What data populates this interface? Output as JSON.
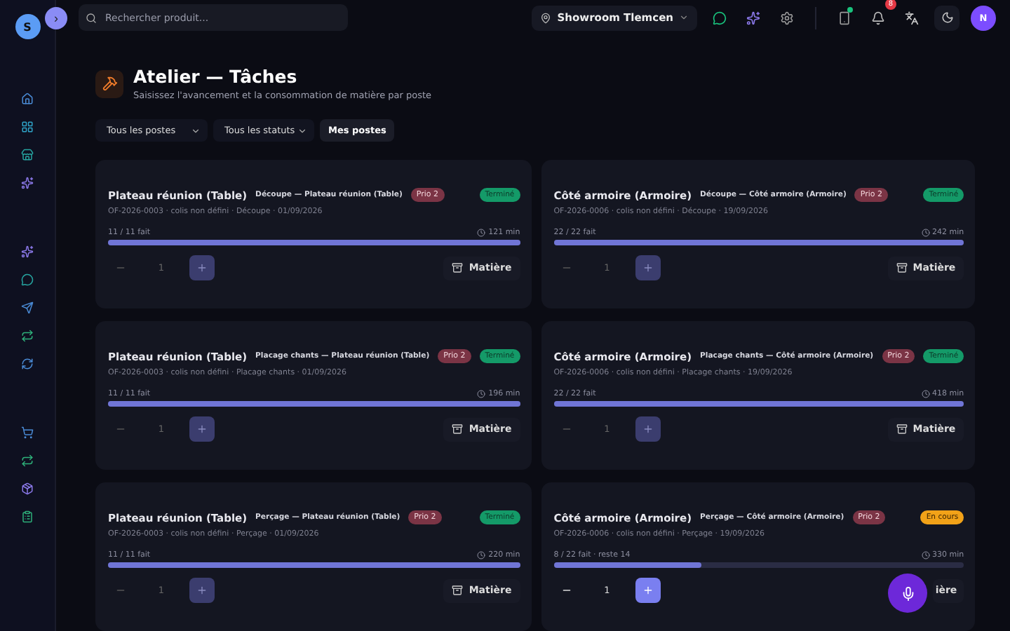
{
  "sidebar": {
    "avatar": "S",
    "expand_button": "›"
  },
  "topbar": {
    "search": {
      "placeholder": "Rechercher produit..."
    },
    "location": "Showroom Tlemcen",
    "notifications": "8",
    "avatar": "N"
  },
  "page": {
    "title": "Atelier — Tâches",
    "subtitle": "Saisissez l'avancement et la consommation de matière par poste"
  },
  "filters": [
    {
      "kind": "select",
      "label": "Tous les postes"
    },
    {
      "kind": "select",
      "label": "Tous les statuts"
    },
    {
      "kind": "button",
      "label": "Mes postes"
    }
  ],
  "tasks": [
    {
      "product": "Plateau réunion (Table)",
      "operation": "Découpe — Plateau réunion (Table)",
      "priority": "Prio 2",
      "status": "Terminé",
      "completed": true,
      "meta": "OF-2026-0003 · colis non défini · Découpe · 01/09/2026",
      "progress": "11 / 11 fait",
      "level": 1,
      "duration": "121 min",
      "quantity": "1",
      "material": "Matière"
    },
    {
      "product": "Côté armoire (Armoire)",
      "operation": "Découpe — Côté armoire (Armoire)",
      "priority": "Prio 2",
      "status": "Terminé",
      "completed": true,
      "meta": "OF-2026-0006 · colis non défini · Découpe · 19/09/2026",
      "progress": "22 / 22 fait",
      "level": 1,
      "duration": "242 min",
      "quantity": "1",
      "material": "Matière"
    },
    {
      "product": "Plateau réunion (Table)",
      "operation": "Placage chants — Plateau réunion (Table)",
      "priority": "Prio 2",
      "status": "Terminé",
      "completed": true,
      "meta": "OF-2026-0003 · colis non défini · Placage chants · 01/09/2026",
      "progress": "11 / 11 fait",
      "level": 1,
      "duration": "196 min",
      "quantity": "1",
      "material": "Matière"
    },
    {
      "product": "Côté armoire (Armoire)",
      "operation": "Placage chants — Côté armoire (Armoire)",
      "priority": "Prio 2",
      "status": "Terminé",
      "completed": true,
      "meta": "OF-2026-0006 · colis non défini · Placage chants · 19/09/2026",
      "progress": "22 / 22 fait",
      "level": 1,
      "duration": "418 min",
      "quantity": "1",
      "material": "Matière"
    },
    {
      "product": "Plateau réunion (Table)",
      "operation": "Perçage — Plateau réunion (Table)",
      "priority": "Prio 2",
      "status": "Terminé",
      "completed": true,
      "meta": "OF-2026-0003 · colis non défini · Perçage · 01/09/2026",
      "progress": "11 / 11 fait",
      "level": 1,
      "duration": "220 min",
      "quantity": "1",
      "material": "Matière"
    },
    {
      "product": "Côté armoire (Armoire)",
      "operation": "Perçage — Côté armoire (Armoire)",
      "priority": "Prio 2",
      "status": "En cours",
      "completed": false,
      "meta": "OF-2026-0006 · colis non défini · Perçage · 19/09/2026",
      "progress": "8 / 22 fait · reste 14",
      "level": 0.36,
      "duration": "330 min",
      "quantity": "1",
      "material": "ière"
    }
  ]
}
